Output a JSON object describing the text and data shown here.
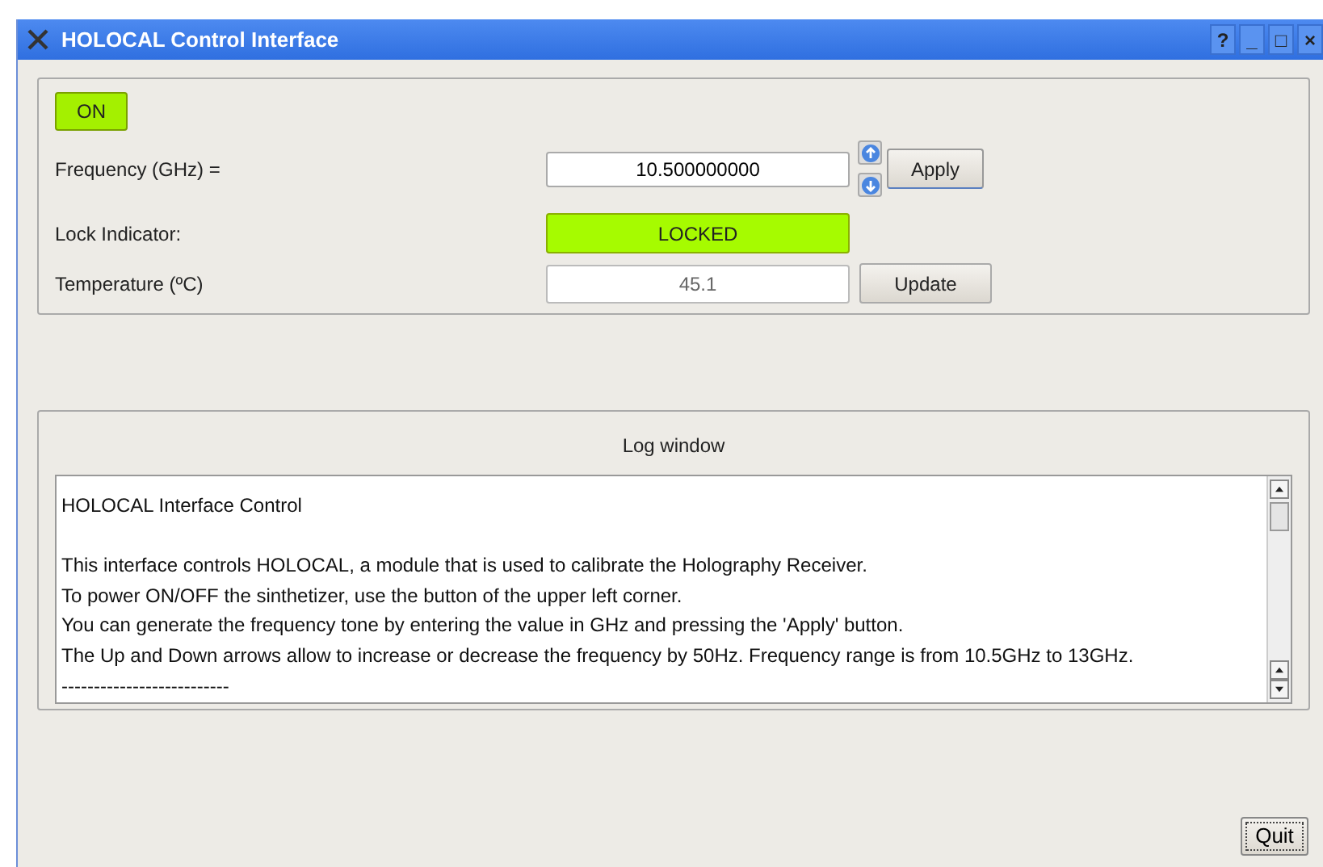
{
  "window": {
    "title": "HOLOCAL Control Interface",
    "title_buttons": [
      "?",
      "_",
      "□",
      "×"
    ]
  },
  "power": {
    "label": "ON",
    "on": true
  },
  "frequency": {
    "label": "Frequency (GHz) =",
    "value": "10.500000000",
    "apply": "Apply"
  },
  "lock": {
    "label": "Lock Indicator:",
    "value": "LOCKED",
    "locked": true
  },
  "temperature": {
    "label": "Temperature (ºC)",
    "value": "45.1",
    "update": "Update"
  },
  "log": {
    "title": "Log window",
    "heading": "HOLOCAL Interface Control",
    "lines": [
      "This interface controls HOLOCAL, a module that is used to calibrate the Holography Receiver.",
      "To power ON/OFF the sinthetizer, use the button of the upper left corner.",
      "You can generate the frequency tone by entering the value in GHz and pressing the 'Apply' button.",
      "The Up and Down arrows allow to increase or decrease the frequency by 50Hz. Frequency range is from 10.5GHz to 13GHz.",
      "--------------------------"
    ]
  },
  "quit": "Quit"
}
